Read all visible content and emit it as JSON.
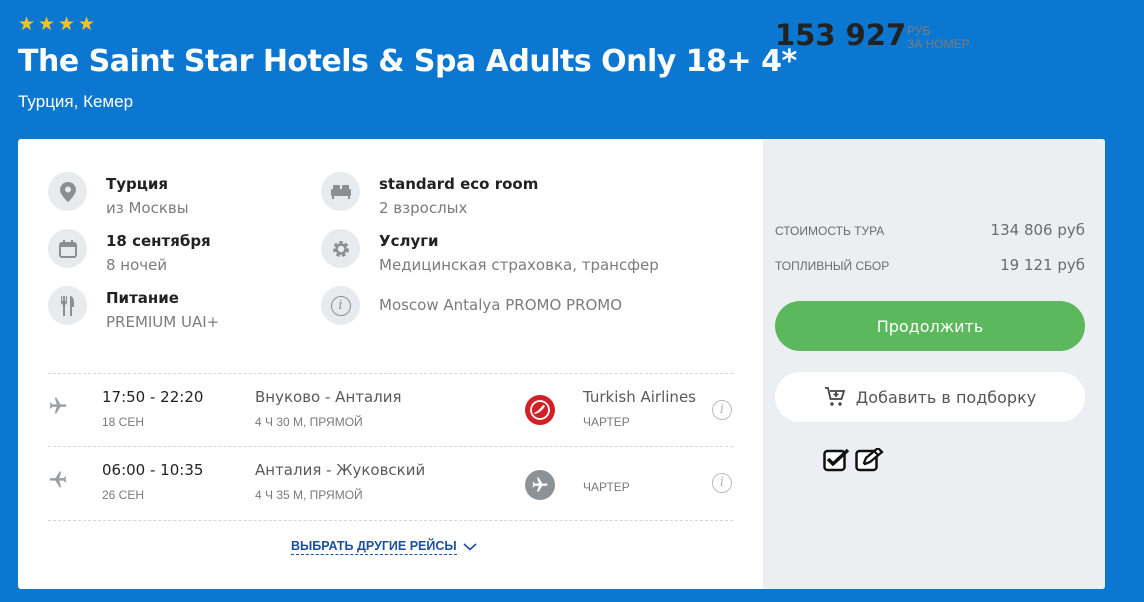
{
  "hotel": {
    "stars": 4,
    "title": "The Saint Star Hotels & Spa Adults Only 18+ 4*",
    "location": "Турция, Кемер"
  },
  "details": {
    "destination": {
      "title": "Турция",
      "sub": "из Москвы",
      "icon": "location-pin-icon"
    },
    "room": {
      "title": "standard eco room",
      "sub": "2 взрослых",
      "icon": "bed-icon"
    },
    "dates": {
      "title": "18 сентября",
      "sub": "8 ночей",
      "icon": "calendar-icon"
    },
    "services": {
      "title": "Услуги",
      "sub": "Медицинская страховка, трансфер",
      "icon": "gear-icon"
    },
    "meals": {
      "title": "Питание",
      "sub": "PREMIUM UAI+",
      "icon": "fork-knife-icon"
    },
    "promo": {
      "text": "Moscow Antalya PROMO PROMO",
      "icon": "info-icon"
    }
  },
  "flights": [
    {
      "time": "17:50 - 22:20",
      "date": "18 СЕН",
      "route": "Внуково - Анталия",
      "duration": "4 Ч 30 М, ПРЯМОЙ",
      "airline": "Turkish Airlines",
      "type": "ЧАРТЕР",
      "logo": "turkish-airlines-logo"
    },
    {
      "time": "06:00 - 10:35",
      "date": "26 СЕН",
      "route": "Анталия - Жуковский",
      "duration": "4 Ч 35 М, ПРЯМОЙ",
      "airline": "",
      "type": "ЧАРТЕР",
      "logo": "generic-plane-logo"
    }
  ],
  "more_flights_label": "ВЫБРАТЬ ДРУГИЕ РЕЙСЫ",
  "pricing": {
    "total": "153 927",
    "unit_line1": "РУБ",
    "unit_line2": "ЗА НОМЕР",
    "tour_cost_label": "СТОИМОСТЬ ТУРА",
    "tour_cost_value": "134 806 руб",
    "fuel_label": "ТОПЛИВНЫЙ СБОР",
    "fuel_value": "19 121 руб"
  },
  "buttons": {
    "continue": "Продолжить",
    "add_to_selection": "Добавить в подборку"
  },
  "colors": {
    "background": "#0b77d1",
    "star": "#f6c223",
    "continue_button": "#5cb85c",
    "link": "#1d4f9a",
    "turkish_red": "#d32027"
  }
}
